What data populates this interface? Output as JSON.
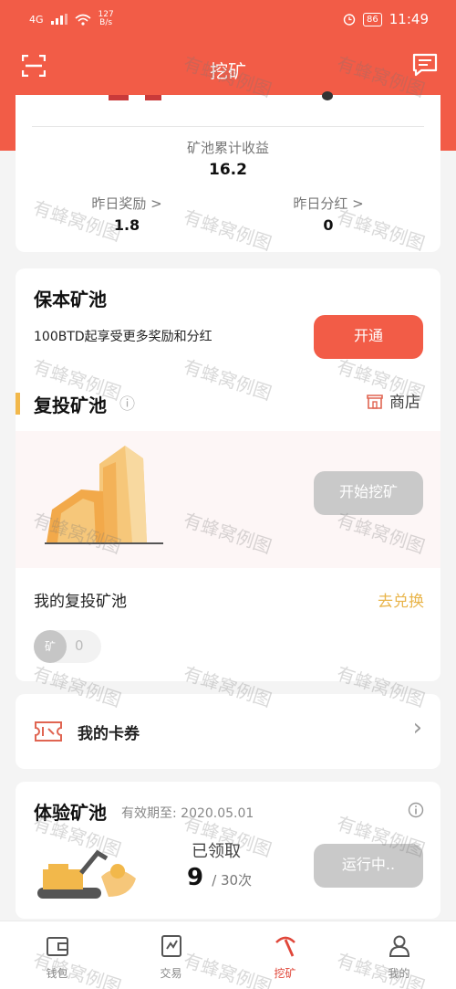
{
  "status_bar": {
    "network": "4G",
    "speed": "127",
    "speed_unit": "B/s",
    "battery": "86",
    "time": "11:49"
  },
  "header": {
    "title": "挖矿"
  },
  "earnings_card": {
    "total_label": "矿池累计收益",
    "total_value": "16.2",
    "yesterday_reward_label": "昨日奖励 >",
    "yesterday_reward_value": "1.8",
    "yesterday_dividend_label": "昨日分红 >",
    "yesterday_dividend_value": "0"
  },
  "principal_pool": {
    "title": "保本矿池",
    "description": "100BTD起享受更多奖励和分红",
    "open_button": "开通"
  },
  "reinvest_pool": {
    "title": "复投矿池",
    "info_icon": "ⓘ",
    "store_label": "商店",
    "start_button": "开始挖矿",
    "my_pool_label": "我的复投矿池",
    "exchange_link": "去兑换",
    "badge_label": "矿",
    "badge_count": "0"
  },
  "coupons": {
    "label": "我的卡券",
    "chevron": "›"
  },
  "trial_pool": {
    "title": "体验矿池",
    "validity": "有效期至: 2020.05.01",
    "claimed_label": "已领取",
    "claimed_count": "9",
    "claimed_total": "/ 30次",
    "running_button": "运行中.."
  },
  "tabbar": [
    {
      "label": "钱包",
      "icon": "wallet-icon"
    },
    {
      "label": "交易",
      "icon": "trade-icon"
    },
    {
      "label": "挖矿",
      "icon": "pickaxe-icon"
    },
    {
      "label": "我的",
      "icon": "user-icon"
    }
  ],
  "watermark": "有蜂窝例图",
  "colors": {
    "primary": "#f25c47",
    "accent": "#f2b84b",
    "link_yellow": "#e9b54b",
    "disabled": "#c9c9c9"
  }
}
